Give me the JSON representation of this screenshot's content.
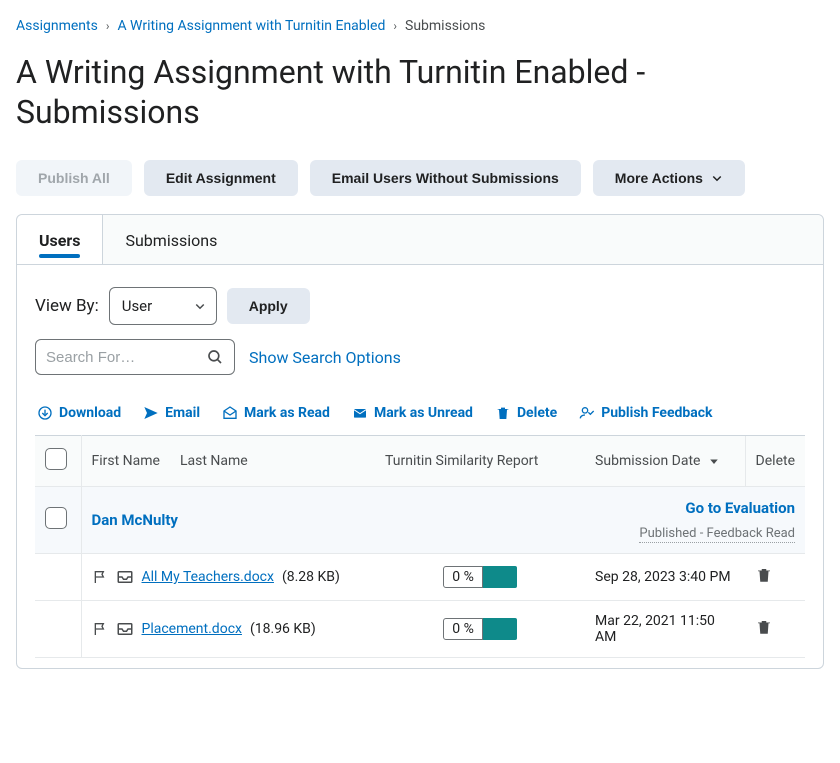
{
  "breadcrumb": {
    "items": [
      {
        "label": "Assignments"
      },
      {
        "label": "A Writing Assignment with Turnitin Enabled"
      }
    ],
    "current": "Submissions"
  },
  "page_title": "A Writing Assignment with Turnitin Enabled - Submissions",
  "top_buttons": {
    "publish_all": "Publish All",
    "edit": "Edit Assignment",
    "email_without": "Email Users Without Submissions",
    "more_actions": "More Actions"
  },
  "tabs": {
    "users": "Users",
    "submissions": "Submissions"
  },
  "viewby": {
    "label": "View By:",
    "value": "User",
    "apply": "Apply"
  },
  "search": {
    "placeholder": "Search For…",
    "show_options": "Show Search Options"
  },
  "actions": {
    "download": "Download",
    "email": "Email",
    "mark_read": "Mark as Read",
    "mark_unread": "Mark as Unread",
    "delete": "Delete",
    "publish_feedback": "Publish Feedback"
  },
  "columns": {
    "first_name": "First Name",
    "last_name": "Last Name",
    "sim_report": "Turnitin Similarity Report",
    "sub_date": "Submission Date",
    "delete": "Delete"
  },
  "student": {
    "name": "Dan McNulty",
    "goto": "Go to Evaluation",
    "status": "Published - Feedback Read"
  },
  "files": [
    {
      "name": "All My Teachers.docx",
      "size": "(8.28 KB)",
      "pct": "0 %",
      "date": "Sep 28, 2023 3:40 PM"
    },
    {
      "name": "Placement.docx",
      "size": "(18.96 KB)",
      "pct": "0 %",
      "date": "Mar 22, 2021 11:50 AM"
    }
  ]
}
